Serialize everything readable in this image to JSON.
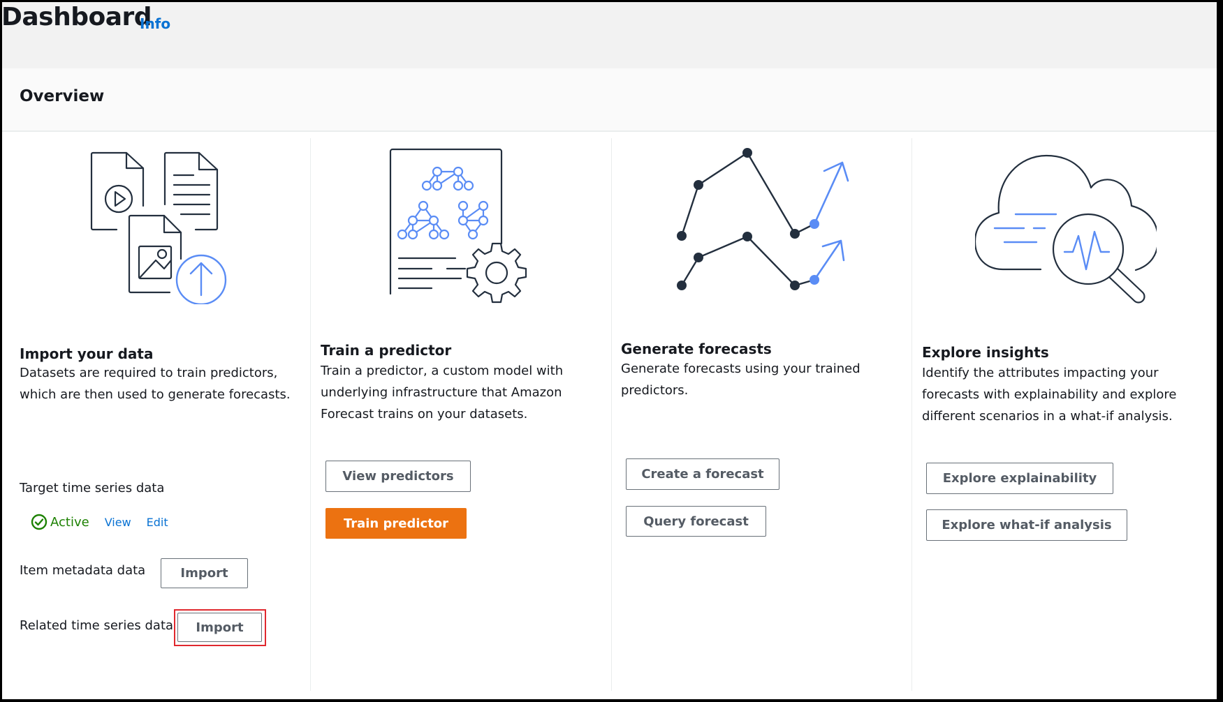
{
  "header": {
    "title": "Dashboard",
    "info_link": "Info"
  },
  "overview": {
    "title": "Overview"
  },
  "colors": {
    "primary_button": "#ec7211",
    "link": "#0972d3",
    "status_active": "#1d8102",
    "highlight": "#e0282e",
    "illustration_accent": "#5a8cf5",
    "illustration_stroke": "#232f3e"
  },
  "columns": [
    {
      "icon": "import-data-illustration",
      "heading": "Import your data",
      "description_lines": [
        "Datasets are required to train predictors,",
        "which are then used to generate forecasts."
      ],
      "datasets": [
        {
          "label": "Target time series data",
          "status": "Active",
          "links": [
            "View",
            "Edit"
          ]
        },
        {
          "label": "Item metadata data",
          "button": "Import"
        },
        {
          "label": "Related time series data",
          "button": "Import",
          "highlighted": true
        }
      ]
    },
    {
      "icon": "train-predictor-illustration",
      "heading": "Train a predictor",
      "description_lines": [
        "Train a predictor, a custom model with",
        "underlying infrastructure that Amazon",
        "Forecast trains on your datasets."
      ],
      "buttons": [
        "View predictors",
        "Train predictor"
      ]
    },
    {
      "icon": "generate-forecasts-illustration",
      "heading": "Generate forecasts",
      "description_lines": [
        "Generate forecasts using your trained",
        "predictors."
      ],
      "buttons": [
        "Create a forecast",
        "Query forecast"
      ]
    },
    {
      "icon": "explore-insights-illustration",
      "heading": "Explore insights",
      "description_lines": [
        "Identify the attributes impacting your",
        "forecasts with explainability and explore",
        "different scenarios in a what-if analysis."
      ],
      "buttons": [
        "Explore explainability",
        "Explore what-if analysis"
      ]
    }
  ]
}
